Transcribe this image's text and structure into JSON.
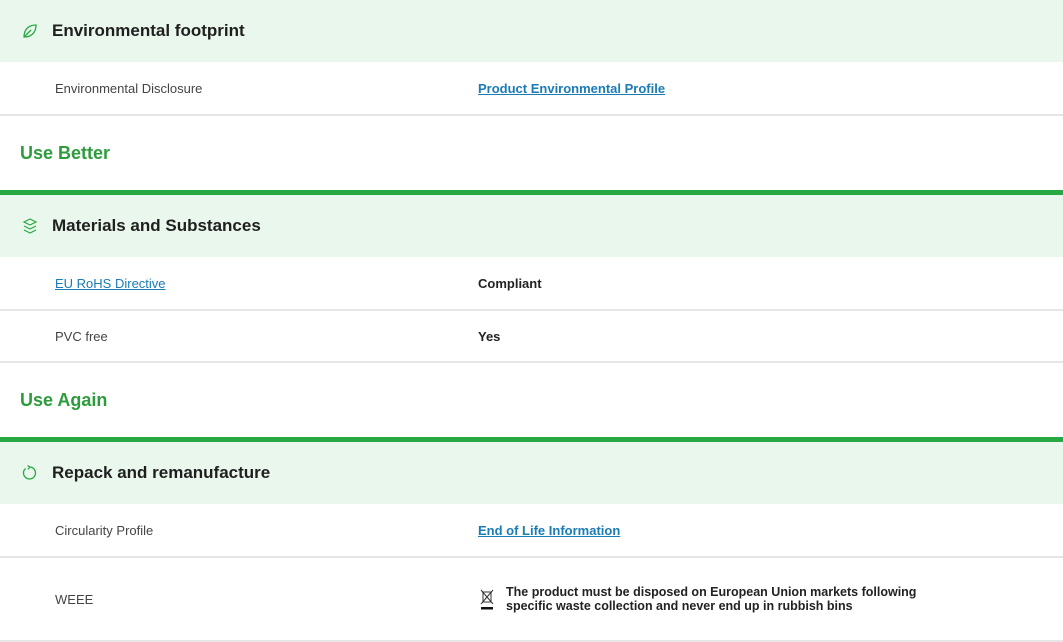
{
  "env_footprint": {
    "icon": "leaf-icon",
    "title": "Environmental footprint",
    "rows": [
      {
        "label": "Environmental Disclosure",
        "value": "Product Environmental Profile"
      }
    ]
  },
  "use_better": {
    "group_title": "Use Better",
    "section": {
      "icon": "layers-icon",
      "title": "Materials and Substances",
      "rows": [
        {
          "label": "EU RoHS Directive",
          "value": "Compliant"
        },
        {
          "label": "PVC free",
          "value": "Yes"
        }
      ]
    }
  },
  "use_again": {
    "group_title": "Use Again",
    "section": {
      "icon": "refresh-icon",
      "title": "Repack and remanufacture",
      "rows": [
        {
          "label": "Circularity Profile",
          "value": "End of Life Information"
        },
        {
          "label": "WEEE",
          "value": "The product must be disposed on European Union markets following specific waste collection and never end up in rubbish bins",
          "icon": "crossed-bin-icon"
        }
      ]
    }
  },
  "colors": {
    "accent_green": "#27a843",
    "header_bg": "#eaf7ec",
    "link": "#1a7bb5"
  }
}
